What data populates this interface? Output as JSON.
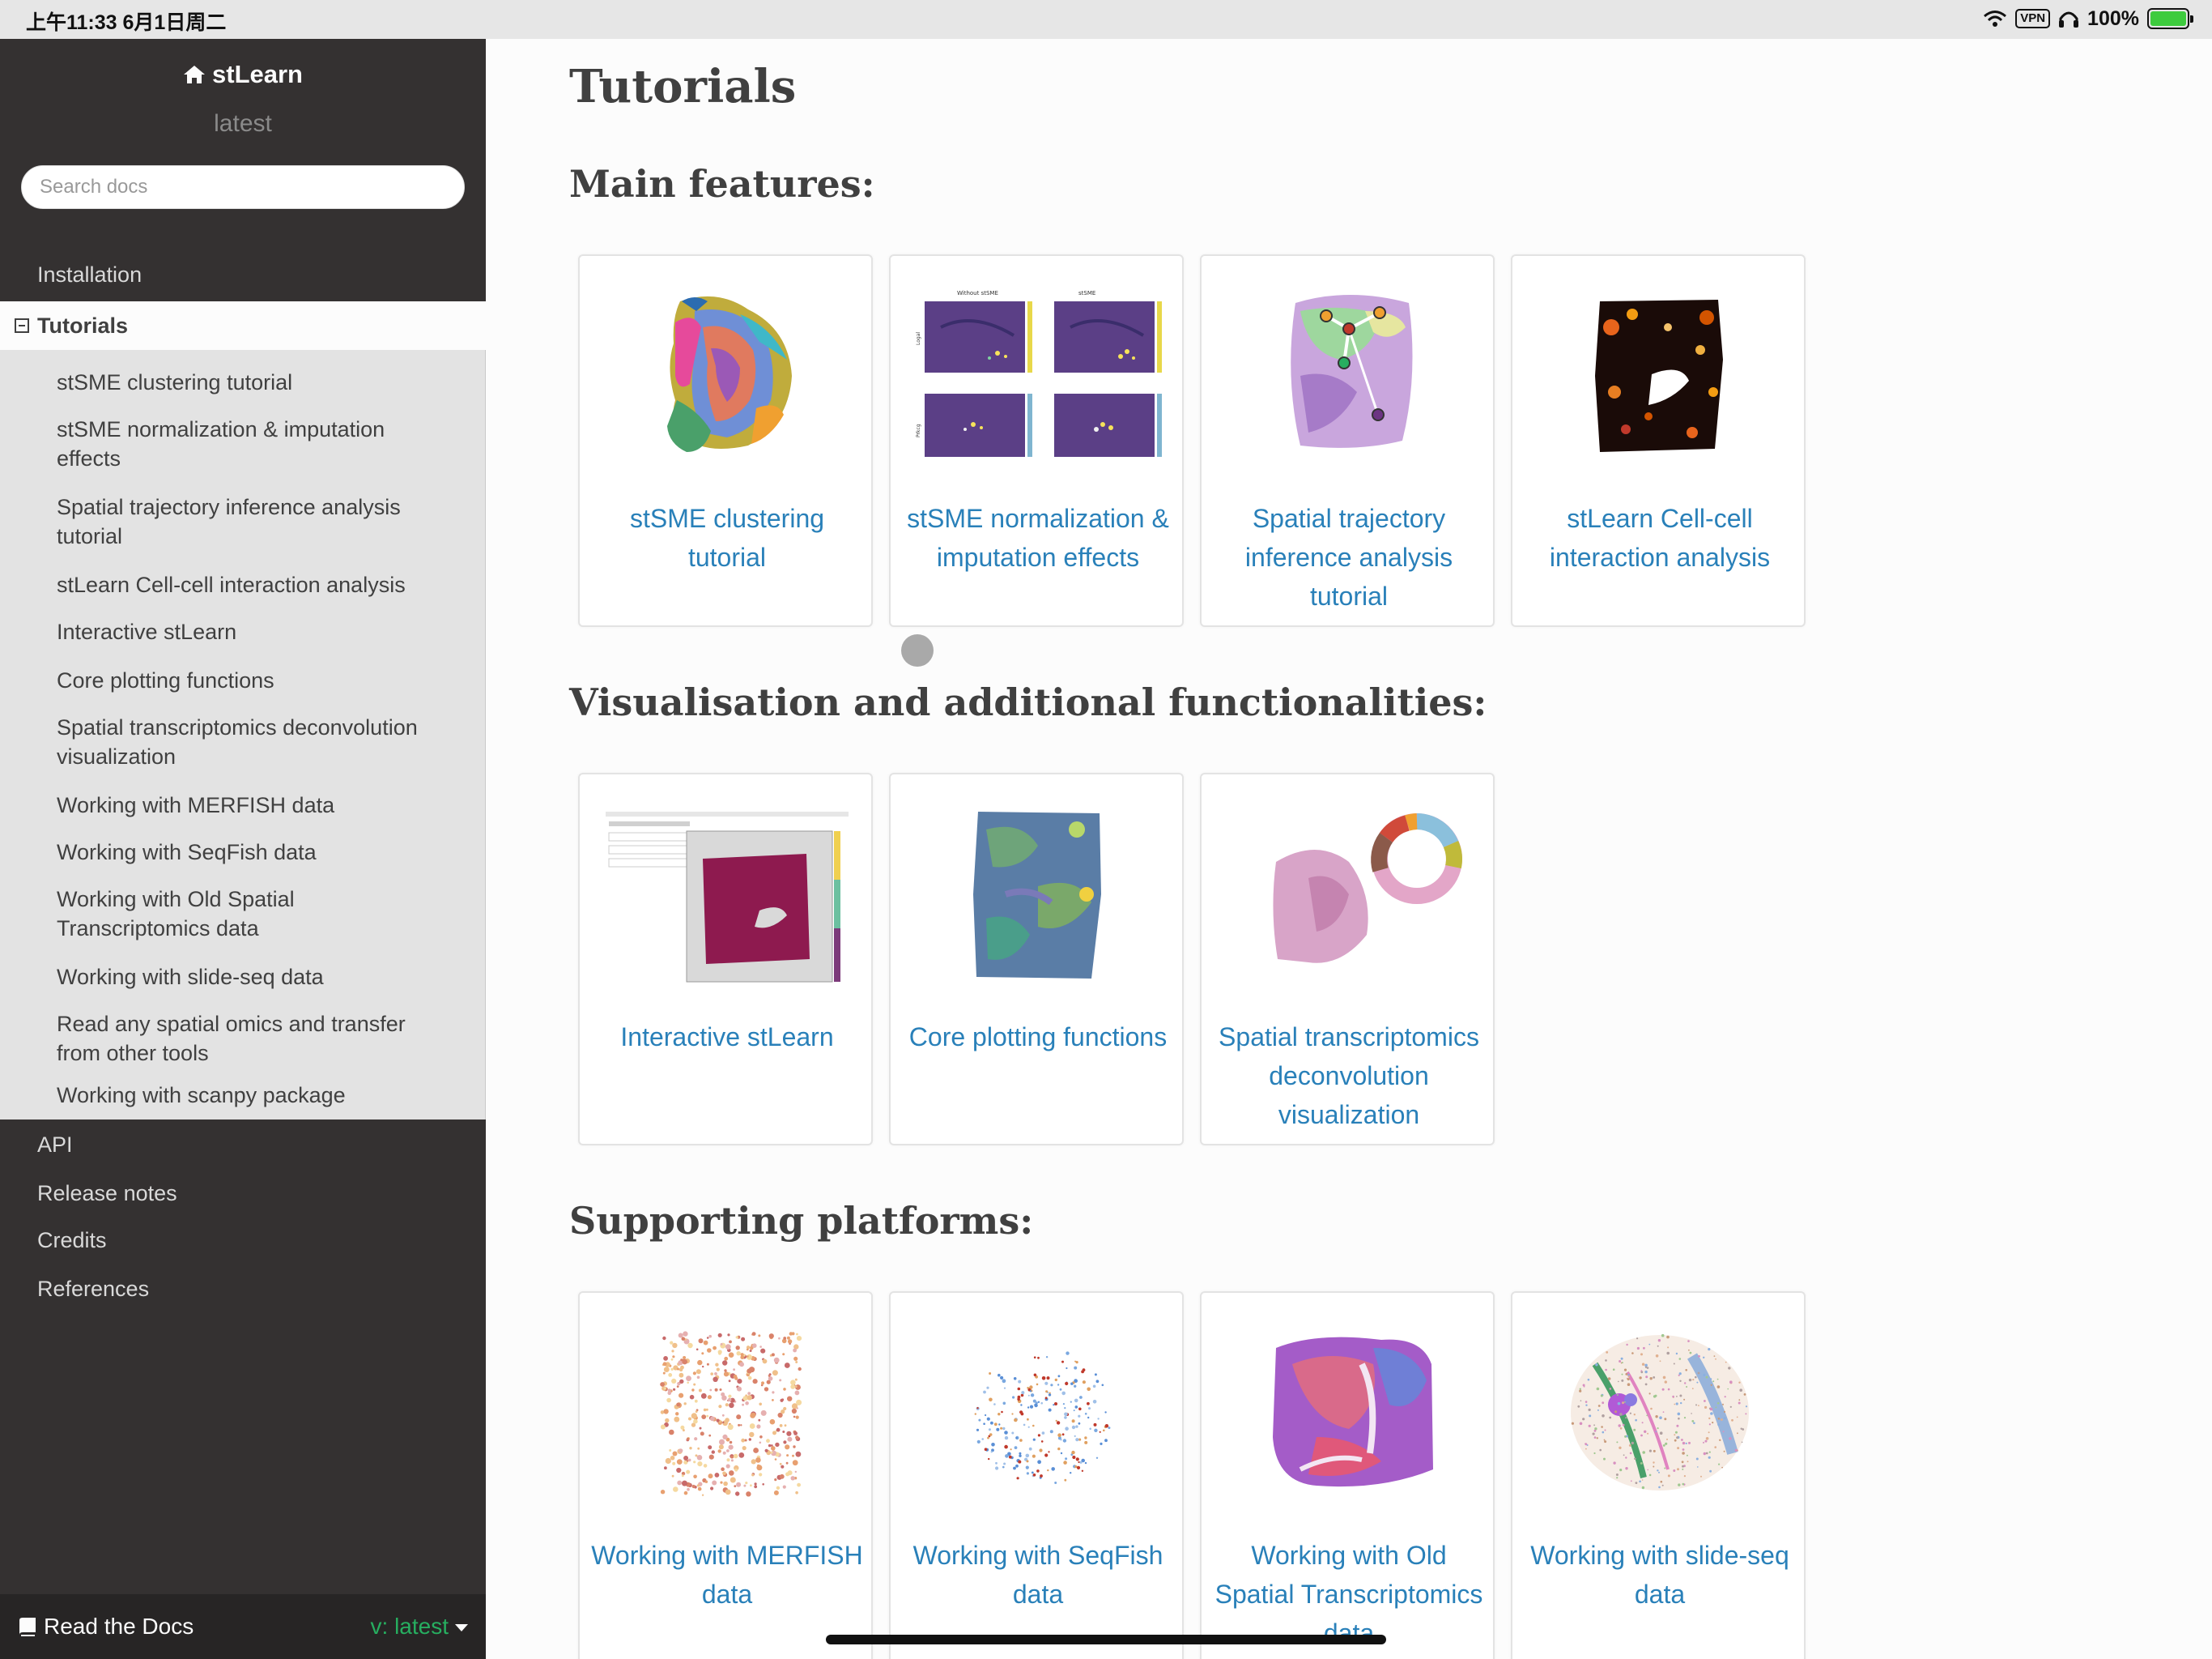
{
  "status_bar": {
    "time": "上午11:33   6月1日周二",
    "vpn": "VPN",
    "battery": "100%",
    "battery_level": 1.0
  },
  "sidebar": {
    "project": "stLearn",
    "version": "latest",
    "search_placeholder": "Search docs",
    "nav": {
      "installation": "Installation",
      "tutorials": "Tutorials",
      "api": "API",
      "release_notes": "Release notes",
      "credits": "Credits",
      "references": "References"
    },
    "tutorial_items": [
      "stSME clustering tutorial",
      "stSME normalization & imputation effects",
      "Spatial trajectory inference analysis tutorial",
      "stLearn Cell-cell interaction analysis",
      "Interactive stLearn",
      "Core plotting functions",
      "Spatial transcriptomics deconvolution visualization",
      "Working with MERFISH data",
      "Working with SeqFish data",
      "Working with Old Spatial Transcriptomics data",
      "Working with slide-seq data",
      "Read any spatial omics and transfer from other tools",
      "Working with scanpy package"
    ],
    "footer": {
      "label": "Read the Docs",
      "version": "v: latest"
    }
  },
  "main": {
    "title": "Tutorials",
    "sections": [
      {
        "heading": "Main features:",
        "cards": [
          "stSME clustering tutorial",
          "stSME normalization & imputation effects",
          "Spatial trajectory inference analysis tutorial",
          "stLearn Cell-cell interaction analysis"
        ]
      },
      {
        "heading": "Visualisation and additional functionalities:",
        "cards": [
          "Interactive stLearn",
          "Core plotting functions",
          "Spatial transcriptomics deconvolution visualization"
        ]
      },
      {
        "heading": "Supporting platforms:",
        "cards": [
          "Working with MERFISH data",
          "Working with SeqFish data",
          "Working with Old Spatial Transcriptomics data",
          "Working with slide-seq data"
        ]
      }
    ],
    "thumb_labels": {
      "without": "Without stSME",
      "with": "stSME",
      "row1": "Logal",
      "row2": "Prkcg"
    }
  },
  "colors": {
    "sidebar_bg": "#343131",
    "link": "#2980b9",
    "heading": "#404040",
    "rtd_version": "#27ae60"
  }
}
